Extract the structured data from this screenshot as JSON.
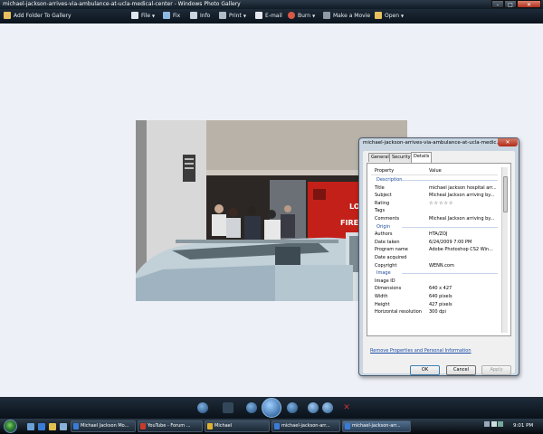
{
  "window": {
    "title": "michael-jackson-arrives-via-ambulance-at-ucla-medical-center - Windows Photo Gallery"
  },
  "window_controls": {
    "minimize": "–",
    "maximize": "□",
    "close": "✕"
  },
  "toolbar": {
    "items": [
      {
        "label": "Add Folder To Gallery",
        "icon": "add-folder-icon"
      },
      {
        "label": "File",
        "icon": "file-icon",
        "dropdown": true
      },
      {
        "label": "Fix",
        "icon": "fix-icon"
      },
      {
        "label": "Info",
        "icon": "info-icon"
      },
      {
        "label": "Print",
        "icon": "print-icon",
        "dropdown": true
      },
      {
        "label": "E-mail",
        "icon": "email-icon"
      },
      {
        "label": "Burn",
        "icon": "burn-icon",
        "dropdown": true
      },
      {
        "label": "Make a Movie",
        "icon": "movie-icon"
      },
      {
        "label": "Open",
        "icon": "open-icon",
        "dropdown": true
      }
    ]
  },
  "photo": {
    "sign_text": "LO\nFIRE"
  },
  "dialog": {
    "title": "michael-jackson-arrives-via-ambulance-at-ucla-medic...",
    "close": "✕",
    "tabs": [
      "General",
      "Security",
      "Details"
    ],
    "active_tab": "Details",
    "columns": {
      "property": "Property",
      "value": "Value"
    },
    "rows": [
      {
        "group": "Description"
      },
      {
        "k": "Title",
        "v": "michael jackson hospital arr..."
      },
      {
        "k": "Subject",
        "v": "Micheal Jackson arriving by..."
      },
      {
        "k": "Rating",
        "v": "☆☆☆☆☆",
        "stars": true
      },
      {
        "k": "Tags",
        "v": ""
      },
      {
        "k": "Comments",
        "v": "Micheal Jackson arriving by..."
      },
      {
        "group": "Origin"
      },
      {
        "k": "Authors",
        "v": "HTA/ZOJ"
      },
      {
        "k": "Date taken",
        "v": "6/24/2009 7:00 PM"
      },
      {
        "k": "Program name",
        "v": "Adobe Photoshop CS2 Win..."
      },
      {
        "k": "Date acquired",
        "v": ""
      },
      {
        "k": "Copyright",
        "v": "WENN.com"
      },
      {
        "group": "Image"
      },
      {
        "k": "Image ID",
        "v": ""
      },
      {
        "k": "Dimensions",
        "v": "640 x 427"
      },
      {
        "k": "Width",
        "v": "640 pixels"
      },
      {
        "k": "Height",
        "v": "427 pixels"
      },
      {
        "k": "Horizontal resolution",
        "v": "300 dpi"
      }
    ],
    "link": "Remove Properties and Personal Information",
    "buttons": {
      "ok": "OK",
      "cancel": "Cancel",
      "apply": "Apply"
    }
  },
  "taskbar": {
    "tasks": [
      {
        "label": "Michael Jackson Mo...",
        "icon_color": "#3a7bd5"
      },
      {
        "label": "YouTube - Forum ...",
        "icon_color": "#c83a2a"
      },
      {
        "label": "Michael",
        "icon_color": "#e0b030"
      },
      {
        "label": "michael-jackson-arr...",
        "icon_color": "#3a7bd5"
      },
      {
        "label": "michael-jackson-arr...",
        "icon_color": "#3a7bd5",
        "active": true
      }
    ],
    "clock": "9:01 PM"
  },
  "colors": {
    "accent": "#1a4aa8",
    "title_bg": "#1e2b38",
    "content_bg": "#eef0f7"
  }
}
